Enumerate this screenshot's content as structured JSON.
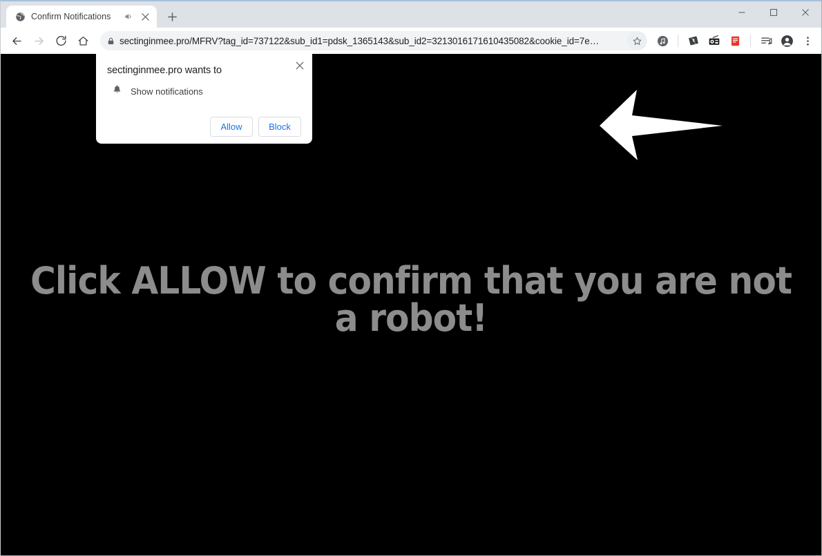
{
  "window": {
    "controls": [
      {
        "name": "minimize",
        "glyph": "minimize-icon"
      },
      {
        "name": "maximize",
        "glyph": "maximize-icon"
      },
      {
        "name": "close",
        "glyph": "close-icon"
      }
    ]
  },
  "tab": {
    "title": "Confirm Notifications",
    "favicon": "globe-icon",
    "audio_icon": "speaker-icon",
    "close_icon": "close-icon",
    "new_tab_icon": "plus-icon"
  },
  "toolbar": {
    "back_icon": "arrow-left-icon",
    "forward_icon": "arrow-right-icon",
    "reload_icon": "reload-icon",
    "home_icon": "home-icon",
    "lock_icon": "lock-icon",
    "url": "sectinginmee.pro/MFRV?tag_id=737122&sub_id1=pdsk_1365143&sub_id2=3213016171610435082&cookie_id=7e…",
    "star_icon": "star-icon",
    "extensions": [
      {
        "name": "music-extension-icon",
        "label": "music-note-badge"
      },
      {
        "name": "dark-card-extension-icon",
        "label": "angled-card"
      },
      {
        "name": "radio-extension-icon",
        "label": "radio"
      },
      {
        "name": "pdf-extension-icon",
        "label": "red-pdf"
      }
    ],
    "media_icon": "media-playlist-icon",
    "profile_icon": "profile-avatar-icon",
    "menu_icon": "three-dot-menu-icon"
  },
  "permission_dialog": {
    "title": "sectinginmee.pro wants to",
    "permission_icon": "bell-icon",
    "permission_label": "Show notifications",
    "allow_label": "Allow",
    "block_label": "Block",
    "close_icon": "close-icon"
  },
  "page": {
    "background_color": "#000000",
    "headline": "Click ALLOW to confirm that you are not a robot!",
    "headline_color": "#8c8c8c",
    "arrow_icon": "left-arrow-pointer",
    "arrow_color": "#ffffff"
  },
  "colors": {
    "chrome_frame": "#dee1e6",
    "toolbar": "#ffffff",
    "omnibox": "#f1f3f4",
    "link_blue": "#1a73e8",
    "text_primary": "#202124"
  }
}
